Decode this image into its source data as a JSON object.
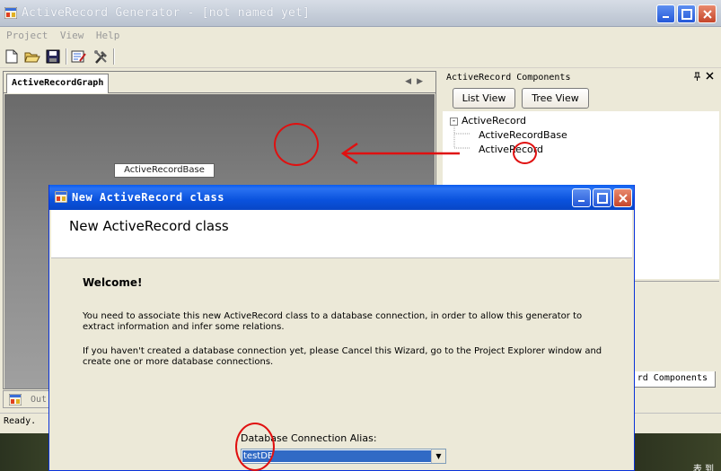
{
  "main_window": {
    "title": "ActiveRecord Generator - [not named yet]",
    "menu": [
      "Project",
      "View",
      "Help"
    ],
    "toolbar_icons": [
      "new-file-icon",
      "open-folder-icon",
      "save-icon",
      "edit-icon",
      "tools-icon"
    ]
  },
  "document": {
    "tab_label": "ActiveRecordGraph",
    "node_label": "ActiveRecordBase"
  },
  "right_panel": {
    "title": "ActiveRecord Components",
    "list_view_label": "List View",
    "tree_view_label": "Tree View",
    "tree": {
      "root": "ActiveRecord",
      "root_toggle": "-",
      "children": [
        "ActiveRecordBase",
        "ActiveRecord"
      ]
    },
    "bottom_tab_label": "rd Components"
  },
  "output_tab_label": "Out",
  "status_text": "Ready.",
  "dialog": {
    "title": "New ActiveRecord class",
    "heading": "New ActiveRecord class",
    "welcome": "Welcome!",
    "paragraph1": "You need to associate this new ActiveRecord class to a database connection, in order to allow this generator to extract information and infer some relations.",
    "paragraph2": "If you haven't created a database connection yet, please Cancel this Wizard, go to the Project Explorer window and create one or more database connections.",
    "field_label": "Database Connection Alias:",
    "select_value": "testDB"
  },
  "desktop_text": "表 到",
  "colors": {
    "annotation": "#e01010",
    "dialog_title": "#0a52dd",
    "selection": "#316ac5"
  }
}
